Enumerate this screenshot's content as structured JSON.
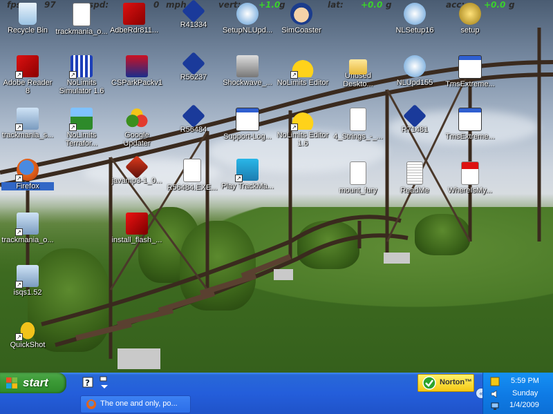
{
  "hud": {
    "fps_label": "fps:",
    "fps_value": "97",
    "speed_label": "spd:",
    "speed_value": "0",
    "speed_unit": "mph",
    "vert_label": "vert:",
    "vert_value": "+1.0",
    "vert_unit": "g",
    "lat_label": "lat:",
    "lat_value": "+0.0",
    "lat_unit": "g",
    "acc_label": "acc:",
    "acc_value": "+0.0",
    "acc_unit": "g"
  },
  "desktop_icons": [
    {
      "label": "Recycle Bin",
      "icon": "recycle-bin-icon"
    },
    {
      "label": "trackmania_o...",
      "icon": "document-icon"
    },
    {
      "label": "AdbeRdr811...",
      "icon": "adobe-reader-icon"
    },
    {
      "label": "R41334",
      "icon": "nolimits-icon"
    },
    {
      "label": "SetupNLUpd...",
      "icon": "installer-icon"
    },
    {
      "label": "SimCoaster",
      "icon": "simcoaster-icon"
    },
    {
      "label": "NLSetup16",
      "icon": "installer-icon"
    },
    {
      "label": "setup",
      "icon": "setup-icon"
    },
    {
      "label": "Adobe Reader 8",
      "icon": "adobe-reader-icon"
    },
    {
      "label": "NoLimits Simulator 1.6",
      "icon": "nolimits-icon"
    },
    {
      "label": "CSParkPackv1",
      "icon": "park-icon"
    },
    {
      "label": "R56237",
      "icon": "nolimits-icon"
    },
    {
      "label": "Shockwave_...",
      "icon": "shockwave-icon"
    },
    {
      "label": "NoLimits Editor",
      "icon": "hardhat-icon"
    },
    {
      "label": "Unused Deskto...",
      "icon": "folder-icon"
    },
    {
      "label": "NLUpd155",
      "icon": "installer-icon"
    },
    {
      "label": "TmsExtreme...",
      "icon": "window-icon"
    },
    {
      "label": "trackmania_s...",
      "icon": "setup-computer-icon"
    },
    {
      "label": "NoLimits Terrafor...",
      "icon": "terraformer-icon"
    },
    {
      "label": "Google Updater",
      "icon": "google-updater-icon"
    },
    {
      "label": "R56484",
      "icon": "nolimits-icon"
    },
    {
      "label": "Support-Log...",
      "icon": "window-icon"
    },
    {
      "label": "NoLimits Editor 1.6",
      "icon": "hardhat-icon"
    },
    {
      "label": "4_Strings_-_...",
      "icon": "mp3-icon"
    },
    {
      "label": "R71481",
      "icon": "nolimits-icon"
    },
    {
      "label": "TmsExtreme...",
      "icon": "window-icon"
    },
    {
      "label": "Firefox",
      "icon": "firefox-icon"
    },
    {
      "label": "javamp3-1_0...",
      "icon": "javamp3-icon"
    },
    {
      "label": "R56484.EXE...",
      "icon": "document-icon"
    },
    {
      "label": "Play TrackMa...",
      "icon": "trackmania-icon"
    },
    {
      "label": "mount_fury",
      "icon": "wmv-icon"
    },
    {
      "label": "ReadMe",
      "icon": "text-file-icon"
    },
    {
      "label": "WhereIsMy...",
      "icon": "pdf-icon"
    },
    {
      "label": "trackmania_o...",
      "icon": "setup-computer-icon"
    },
    {
      "label": "install_flash_...",
      "icon": "flash-icon"
    },
    {
      "label": "isqs1.52",
      "icon": "setup-computer-icon"
    },
    {
      "label": "QuickShot",
      "icon": "frog-icon"
    }
  ],
  "taskbar": {
    "start_label": "start",
    "task_window_title": "The one and only, po...",
    "norton_label": "Norton™",
    "tray_chevron": "«",
    "clock_time": "5:59 PM",
    "clock_day": "Sunday",
    "clock_date": "1/4/2009"
  }
}
